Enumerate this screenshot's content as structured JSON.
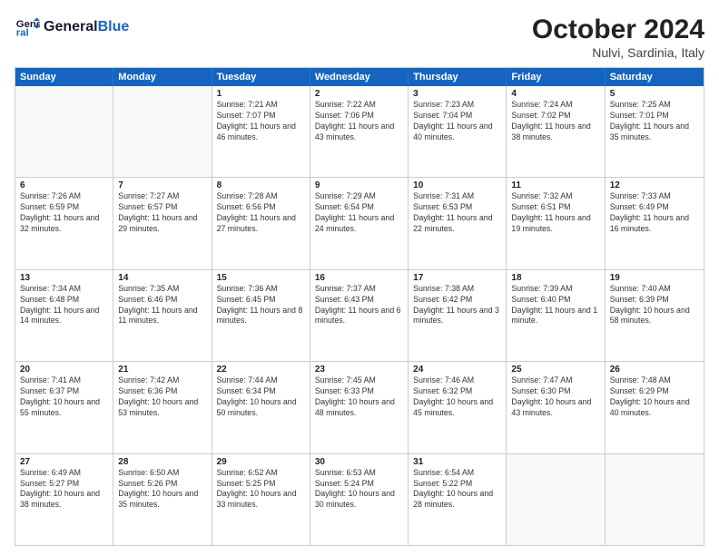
{
  "header": {
    "logo_line1": "General",
    "logo_line2": "Blue",
    "month": "October 2024",
    "location": "Nulvi, Sardinia, Italy"
  },
  "days_of_week": [
    "Sunday",
    "Monday",
    "Tuesday",
    "Wednesday",
    "Thursday",
    "Friday",
    "Saturday"
  ],
  "weeks": [
    [
      {
        "day": "",
        "info": ""
      },
      {
        "day": "",
        "info": ""
      },
      {
        "day": "1",
        "info": "Sunrise: 7:21 AM\nSunset: 7:07 PM\nDaylight: 11 hours and 46 minutes."
      },
      {
        "day": "2",
        "info": "Sunrise: 7:22 AM\nSunset: 7:06 PM\nDaylight: 11 hours and 43 minutes."
      },
      {
        "day": "3",
        "info": "Sunrise: 7:23 AM\nSunset: 7:04 PM\nDaylight: 11 hours and 40 minutes."
      },
      {
        "day": "4",
        "info": "Sunrise: 7:24 AM\nSunset: 7:02 PM\nDaylight: 11 hours and 38 minutes."
      },
      {
        "day": "5",
        "info": "Sunrise: 7:25 AM\nSunset: 7:01 PM\nDaylight: 11 hours and 35 minutes."
      }
    ],
    [
      {
        "day": "6",
        "info": "Sunrise: 7:26 AM\nSunset: 6:59 PM\nDaylight: 11 hours and 32 minutes."
      },
      {
        "day": "7",
        "info": "Sunrise: 7:27 AM\nSunset: 6:57 PM\nDaylight: 11 hours and 29 minutes."
      },
      {
        "day": "8",
        "info": "Sunrise: 7:28 AM\nSunset: 6:56 PM\nDaylight: 11 hours and 27 minutes."
      },
      {
        "day": "9",
        "info": "Sunrise: 7:29 AM\nSunset: 6:54 PM\nDaylight: 11 hours and 24 minutes."
      },
      {
        "day": "10",
        "info": "Sunrise: 7:31 AM\nSunset: 6:53 PM\nDaylight: 11 hours and 22 minutes."
      },
      {
        "day": "11",
        "info": "Sunrise: 7:32 AM\nSunset: 6:51 PM\nDaylight: 11 hours and 19 minutes."
      },
      {
        "day": "12",
        "info": "Sunrise: 7:33 AM\nSunset: 6:49 PM\nDaylight: 11 hours and 16 minutes."
      }
    ],
    [
      {
        "day": "13",
        "info": "Sunrise: 7:34 AM\nSunset: 6:48 PM\nDaylight: 11 hours and 14 minutes."
      },
      {
        "day": "14",
        "info": "Sunrise: 7:35 AM\nSunset: 6:46 PM\nDaylight: 11 hours and 11 minutes."
      },
      {
        "day": "15",
        "info": "Sunrise: 7:36 AM\nSunset: 6:45 PM\nDaylight: 11 hours and 8 minutes."
      },
      {
        "day": "16",
        "info": "Sunrise: 7:37 AM\nSunset: 6:43 PM\nDaylight: 11 hours and 6 minutes."
      },
      {
        "day": "17",
        "info": "Sunrise: 7:38 AM\nSunset: 6:42 PM\nDaylight: 11 hours and 3 minutes."
      },
      {
        "day": "18",
        "info": "Sunrise: 7:39 AM\nSunset: 6:40 PM\nDaylight: 11 hours and 1 minute."
      },
      {
        "day": "19",
        "info": "Sunrise: 7:40 AM\nSunset: 6:39 PM\nDaylight: 10 hours and 58 minutes."
      }
    ],
    [
      {
        "day": "20",
        "info": "Sunrise: 7:41 AM\nSunset: 6:37 PM\nDaylight: 10 hours and 55 minutes."
      },
      {
        "day": "21",
        "info": "Sunrise: 7:42 AM\nSunset: 6:36 PM\nDaylight: 10 hours and 53 minutes."
      },
      {
        "day": "22",
        "info": "Sunrise: 7:44 AM\nSunset: 6:34 PM\nDaylight: 10 hours and 50 minutes."
      },
      {
        "day": "23",
        "info": "Sunrise: 7:45 AM\nSunset: 6:33 PM\nDaylight: 10 hours and 48 minutes."
      },
      {
        "day": "24",
        "info": "Sunrise: 7:46 AM\nSunset: 6:32 PM\nDaylight: 10 hours and 45 minutes."
      },
      {
        "day": "25",
        "info": "Sunrise: 7:47 AM\nSunset: 6:30 PM\nDaylight: 10 hours and 43 minutes."
      },
      {
        "day": "26",
        "info": "Sunrise: 7:48 AM\nSunset: 6:29 PM\nDaylight: 10 hours and 40 minutes."
      }
    ],
    [
      {
        "day": "27",
        "info": "Sunrise: 6:49 AM\nSunset: 5:27 PM\nDaylight: 10 hours and 38 minutes."
      },
      {
        "day": "28",
        "info": "Sunrise: 6:50 AM\nSunset: 5:26 PM\nDaylight: 10 hours and 35 minutes."
      },
      {
        "day": "29",
        "info": "Sunrise: 6:52 AM\nSunset: 5:25 PM\nDaylight: 10 hours and 33 minutes."
      },
      {
        "day": "30",
        "info": "Sunrise: 6:53 AM\nSunset: 5:24 PM\nDaylight: 10 hours and 30 minutes."
      },
      {
        "day": "31",
        "info": "Sunrise: 6:54 AM\nSunset: 5:22 PM\nDaylight: 10 hours and 28 minutes."
      },
      {
        "day": "",
        "info": ""
      },
      {
        "day": "",
        "info": ""
      }
    ]
  ]
}
